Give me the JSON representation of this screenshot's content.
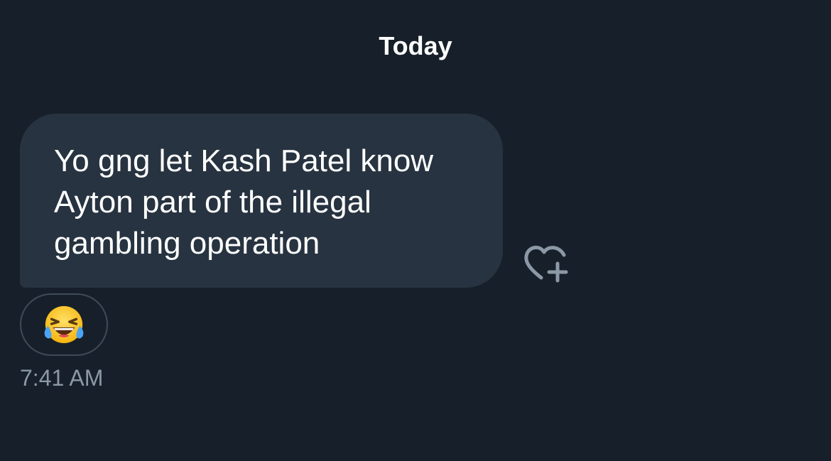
{
  "header": {
    "date_label": "Today"
  },
  "message": {
    "text": "Yo gng let Kash Patel know Ayton part of the illegal gambling operation",
    "timestamp": "7:41 AM",
    "reaction": {
      "emoji_name": "face-with-tears-of-joy-icon"
    },
    "react_button_icon": "heart-plus-icon"
  },
  "colors": {
    "background": "#17202a",
    "bubble": "#273340",
    "text": "#ffffff",
    "muted": "#8b98a5",
    "pill_border": "#3e4b58"
  }
}
